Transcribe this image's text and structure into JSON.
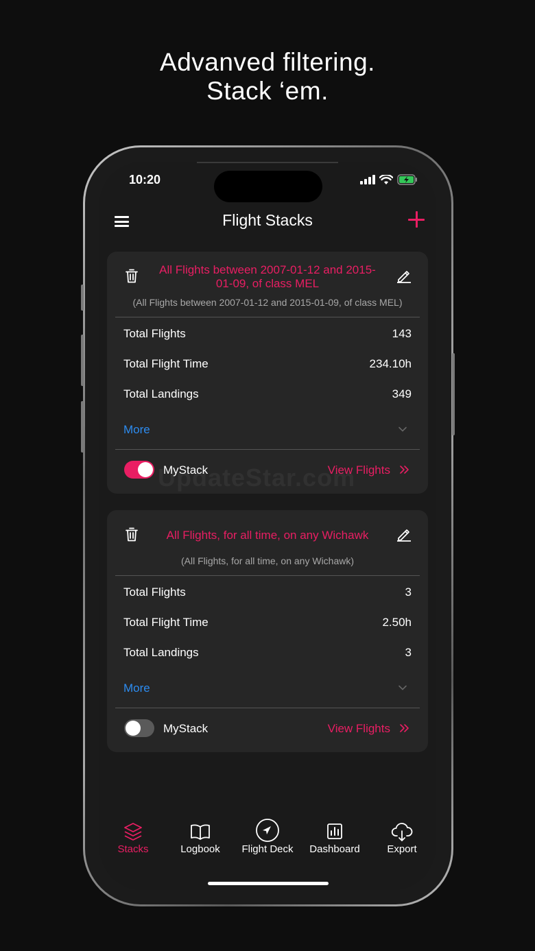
{
  "headline": {
    "line1": "Advanved filtering.",
    "line2": "Stack ‘em."
  },
  "status_bar": {
    "time": "10:20"
  },
  "nav": {
    "title": "Flight Stacks"
  },
  "stacks": [
    {
      "title": "All Flights between 2007-01-12 and 2015-01-09, of class MEL",
      "subtitle": "(All Flights between 2007-01-12 and 2015-01-09, of class MEL)",
      "stats": [
        {
          "label": "Total Flights",
          "value": "143"
        },
        {
          "label": "Total Flight Time",
          "value": "234.10h"
        },
        {
          "label": "Total Landings",
          "value": "349"
        }
      ],
      "more_label": "More",
      "toggle_label": "MyStack",
      "toggle_on": true,
      "view_label": "View Flights"
    },
    {
      "title": "All Flights, for all time, on any Wichawk",
      "subtitle": "(All Flights, for all time, on any Wichawk)",
      "stats": [
        {
          "label": "Total Flights",
          "value": "3"
        },
        {
          "label": "Total Flight Time",
          "value": "2.50h"
        },
        {
          "label": "Total Landings",
          "value": "3"
        }
      ],
      "more_label": "More",
      "toggle_label": "MyStack",
      "toggle_on": false,
      "view_label": "View Flights"
    }
  ],
  "tabs": [
    {
      "label": "Stacks",
      "icon": "stacks-icon",
      "active": true
    },
    {
      "label": "Logbook",
      "icon": "book-icon",
      "active": false
    },
    {
      "label": "Flight Deck",
      "icon": "plane-compass-icon",
      "active": false
    },
    {
      "label": "Dashboard",
      "icon": "bar-chart-icon",
      "active": false
    },
    {
      "label": "Export",
      "icon": "cloud-download-icon",
      "active": false
    }
  ],
  "watermark": "UpdateStar.com",
  "colors": {
    "accent": "#e91e63",
    "link": "#2d8cf0",
    "card": "#262626",
    "background": "#0e0e0e"
  }
}
